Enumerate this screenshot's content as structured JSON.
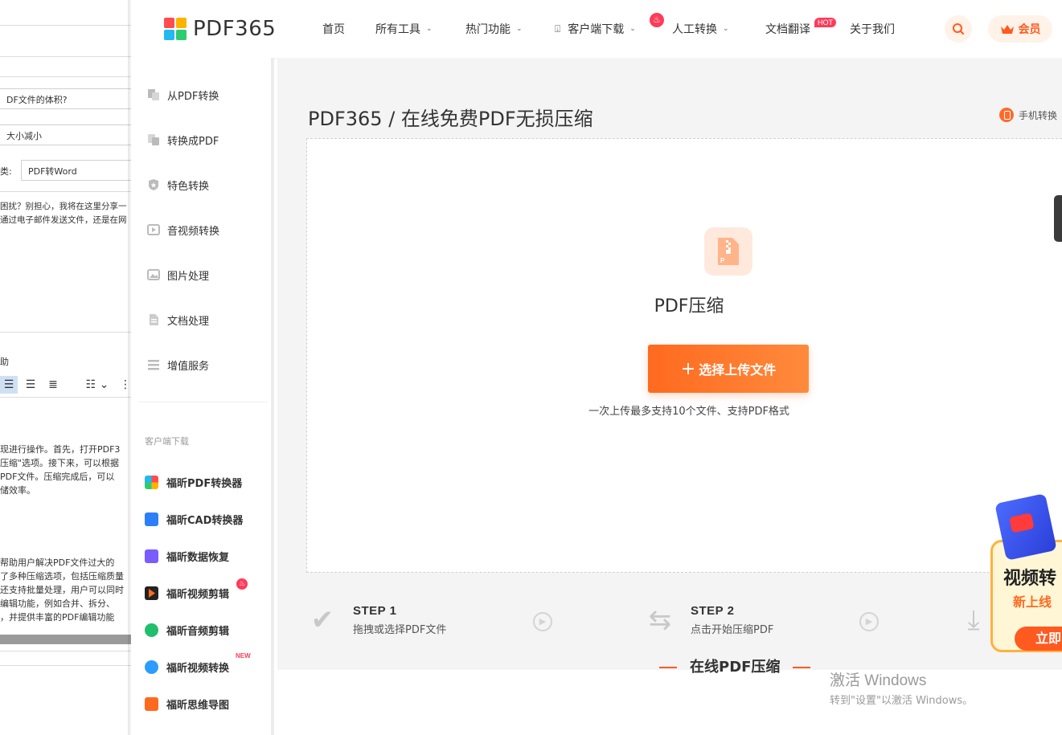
{
  "background_editor": {
    "lines": [
      "DF文件的体积?",
      "大小减小"
    ],
    "category_label": "类:",
    "category_value": "PDF转Word",
    "intro_lines": [
      "困扰？别担心，我将在这里分享一",
      "通过电子邮件发送文件，还是在网"
    ],
    "help_label": "助",
    "body_lines_a": [
      "现进行操作。首先，打开PDF3",
      "压缩\"选项。接下来，可以根据",
      "PDF文件。压缩完成后，可以",
      "储效率。"
    ],
    "body_lines_b": [
      "帮助用户解决PDF文件过大的",
      "了多种压缩选项，包括压缩质量",
      "还支持批量处理，用户可以同时",
      "编辑功能，例如合并、拆分、",
      "，并提供丰富的PDF编辑功能"
    ]
  },
  "header": {
    "logo_text": "PDF365",
    "logo_colors": [
      "#ff4d4f",
      "#ffb300",
      "#22b8f0",
      "#2ecc71"
    ],
    "nav": [
      {
        "label": "首页",
        "dropdown": false
      },
      {
        "label": "所有工具",
        "dropdown": true
      },
      {
        "label": "热门功能",
        "dropdown": true
      },
      {
        "label": "客户端下载",
        "dropdown": true
      },
      {
        "label": "人工转换",
        "dropdown": true
      },
      {
        "label": "文档翻译",
        "dropdown": false
      },
      {
        "label": "关于我们",
        "dropdown": false
      }
    ],
    "hot_badge": "HOT",
    "vip_label": "会员"
  },
  "sidebar": {
    "items": [
      {
        "label": "从PDF转换",
        "icon": "pdf-convert-icon"
      },
      {
        "label": "转换成PDF",
        "icon": "to-pdf-icon"
      },
      {
        "label": "特色转换",
        "icon": "star-shield-icon"
      },
      {
        "label": "音视频转换",
        "icon": "media-icon"
      },
      {
        "label": "图片处理",
        "icon": "image-icon"
      },
      {
        "label": "文档处理",
        "icon": "document-icon"
      },
      {
        "label": "增值服务",
        "icon": "list-icon"
      }
    ],
    "section_label": "客户端下载",
    "apps": [
      {
        "label": "福昕PDF转换器",
        "color": "#f25a5a"
      },
      {
        "label": "福昕CAD转换器",
        "color": "#2d7ff9"
      },
      {
        "label": "福昕数据恢复",
        "color": "#7b5cff"
      },
      {
        "label": "福昕视频剪辑",
        "color": "#ff6a1f"
      },
      {
        "label": "福昕音频剪辑",
        "color": "#1fbf6b"
      },
      {
        "label": "福昕视频转换",
        "color": "#2d9cff"
      },
      {
        "label": "福昕思维导图",
        "color": "#ff6a1f"
      }
    ],
    "new_badge": "NEW"
  },
  "main": {
    "breadcrumb": "PDF365 / 在线免费PDF无损压缩",
    "mobile_link": "手机转换",
    "tool_name": "PDF压缩",
    "upload_button": "选择上传文件",
    "upload_hint": "一次上传最多支持10个文件、支持PDF格式",
    "steps": [
      {
        "title": "STEP 1",
        "desc": "拖拽或选择PDF文件"
      },
      {
        "title": "STEP 2",
        "desc": "点击开始压缩PDF"
      }
    ],
    "section_title": "在线PDF压缩"
  },
  "promo": {
    "title": "视频转",
    "subtitle": "新上线",
    "button": "立即"
  },
  "windows_watermark": {
    "line1": "激活 Windows",
    "line2": "转到\"设置\"以激活 Windows。"
  },
  "colors": {
    "accent": "#ff6a1f",
    "hot": "#ff3b5a",
    "panel_bg": "#f4f4f4"
  }
}
